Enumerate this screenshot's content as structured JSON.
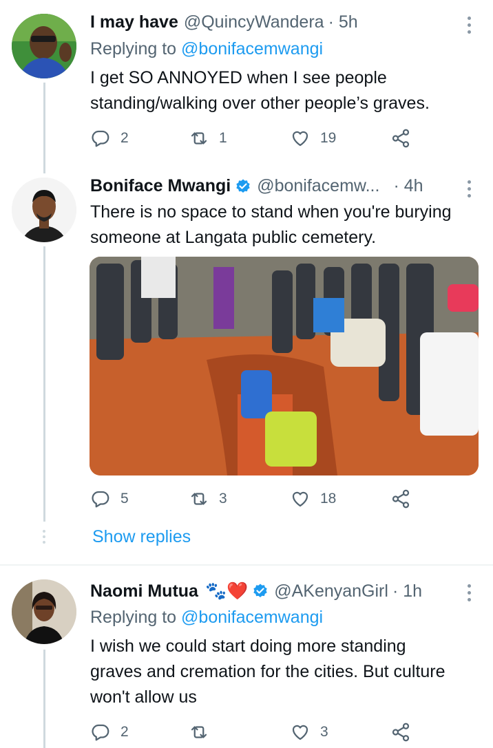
{
  "tweets": [
    {
      "display_name": "I may have",
      "handle": "@QuincyWandera",
      "time": "· 5h",
      "replying_label": "Replying to",
      "replying_to": "@bonifacemwangi",
      "text": "I get SO ANNOYED when I see people standing/walking over other people’s graves.",
      "replies": "2",
      "retweets": "1",
      "likes": "19",
      "verified": false
    },
    {
      "display_name": "Boniface Mwangi",
      "handle": "@bonifacemw...",
      "time": "· 4h",
      "text": "There is no space to stand when you're burying someone at Langata public cemetery.",
      "replies": "5",
      "retweets": "3",
      "likes": "18",
      "verified": true,
      "has_photo": true
    },
    {
      "display_name": "Naomi Mutua",
      "name_emoji": "🐾❤️",
      "handle": "@AKenyanGirl",
      "time": "· 1h",
      "replying_label": "Replying to",
      "replying_to": "@bonifacemwangi",
      "text": "I wish we could start doing more standing graves and cremation for the cities. But culture won't allow us",
      "replies": "2",
      "retweets": "",
      "likes": "3",
      "verified": true
    }
  ],
  "show_replies": "Show replies",
  "colors": {
    "accent": "#1d9bf0",
    "secondary_text": "#536471",
    "thread_line": "#cfd9de"
  },
  "icons": [
    "reply-icon",
    "retweet-icon",
    "like-icon",
    "share-icon",
    "more-icon",
    "verified-badge-icon"
  ]
}
